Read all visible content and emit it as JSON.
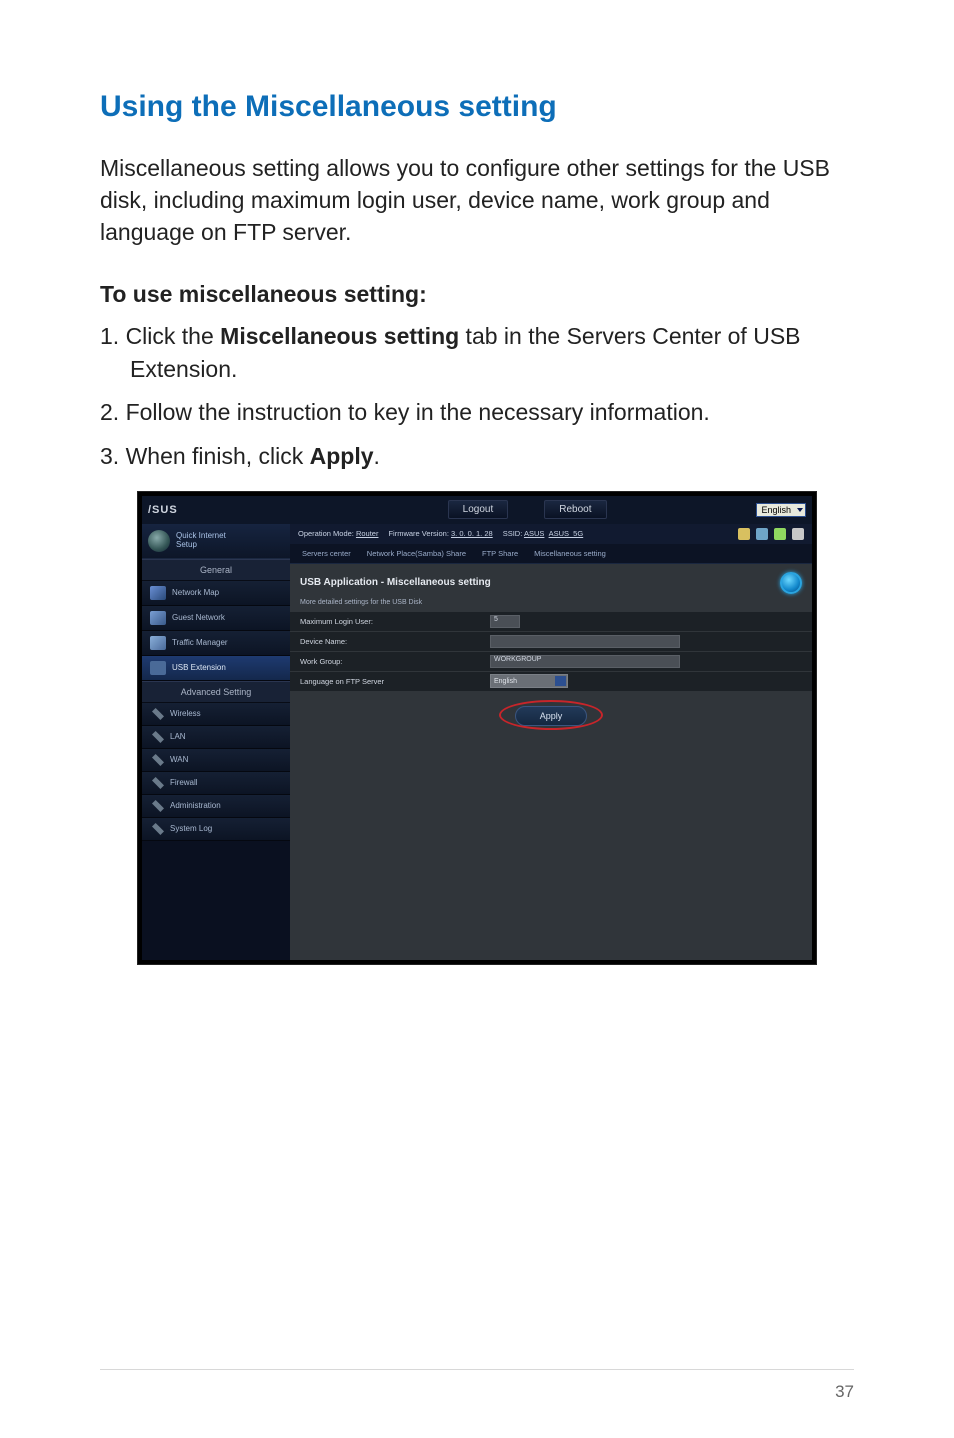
{
  "heading": "Using the Miscellaneous setting",
  "intro": "Miscellaneous setting allows you to configure other settings for the USB disk, including maximum login user, device name, work group and language on FTP server.",
  "sub_heading": "To use miscellaneous setting:",
  "steps": {
    "s1a": "1.  Click the ",
    "s1b": "Miscellaneous setting",
    "s1c": " tab in the Servers Center of USB Extension.",
    "s2": "2.  Follow the instruction to key in the necessary information.",
    "s3a": "3.  When finish, click ",
    "s3b": "Apply",
    "s3c": "."
  },
  "router": {
    "logo": "/SUS",
    "btn_logout": "Logout",
    "btn_reboot": "Reboot",
    "lang": "English",
    "qis_line1": "Quick Internet",
    "qis_line2": "Setup",
    "section_general": "General",
    "section_advanced": "Advanced Setting",
    "nav": {
      "network_map": "Network Map",
      "guest_network": "Guest Network",
      "traffic_manager": "Traffic Manager",
      "usb_extension": "USB Extension",
      "wireless": "Wireless",
      "lan": "LAN",
      "wan": "WAN",
      "firewall": "Firewall",
      "administration": "Administration",
      "system_log": "System Log"
    },
    "opbar": {
      "mode_label": "Operation Mode: ",
      "mode_val": "Router",
      "fw_label": "Firmware Version: ",
      "fw_val": "3. 0. 0. 1. 28",
      "ssid_label": "SSID: ",
      "ssid1": "ASUS",
      "ssid2": "ASUS_5G"
    },
    "tabs": {
      "servers": "Servers center",
      "samba": "Network Place(Samba) Share",
      "ftp": "FTP Share",
      "misc": "Miscellaneous setting"
    },
    "pane_title": "USB Application - Miscellaneous setting",
    "pane_sub": "More detailed settings for the USB Disk",
    "form": {
      "max_login_label": "Maximum Login User:",
      "max_login_val": "5",
      "device_name_label": "Device Name:",
      "device_name_val": "",
      "workgroup_label": "Work Group:",
      "workgroup_val": "WORKGROUP",
      "ftp_lang_label": "Language on FTP Server",
      "ftp_lang_val": "English"
    },
    "apply": "Apply"
  },
  "page_num": "37"
}
